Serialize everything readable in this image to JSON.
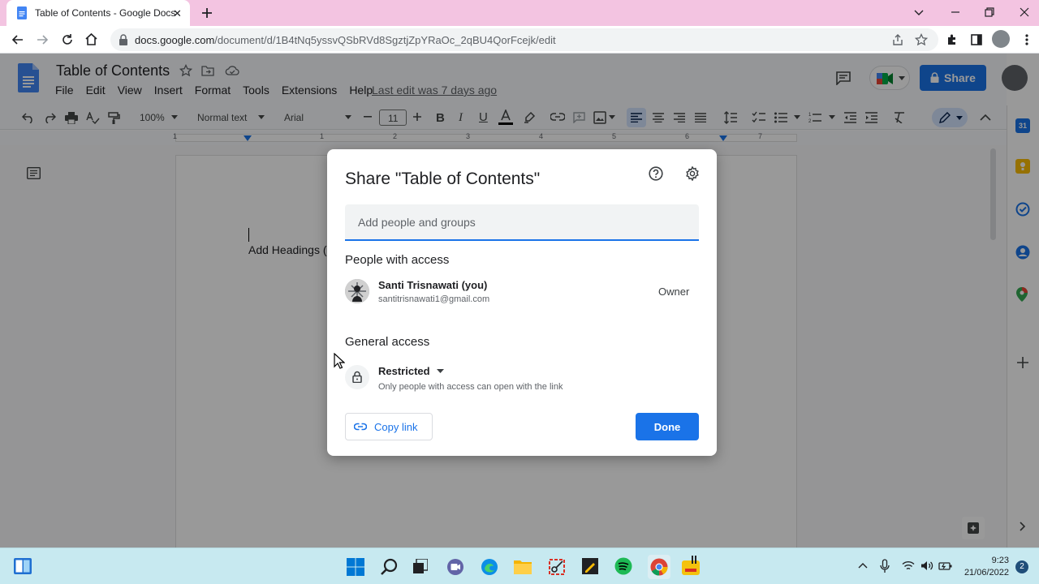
{
  "browser": {
    "tab_title": "Table of Contents - Google Docs",
    "url_host": "docs.google.com",
    "url_path": "/document/d/1B4tNq5yssvQSbRVd8SgztjZpYRaOc_2qBU4QorFcejk/edit"
  },
  "docs": {
    "title": "Table of Contents",
    "menu": [
      "File",
      "Edit",
      "View",
      "Insert",
      "Format",
      "Tools",
      "Extensions",
      "Help"
    ],
    "last_edit": "Last edit was 7 days ago",
    "share_label": "Share",
    "toolbar": {
      "zoom": "100%",
      "style": "Normal text",
      "font": "Arial",
      "font_size": "11"
    },
    "ruler_numbers": [
      "1",
      "1",
      "2",
      "3",
      "4",
      "5",
      "6",
      "7"
    ],
    "page_text": "Add Headings ("
  },
  "dialog": {
    "title": "Share \"Table of Contents\"",
    "input_placeholder": "Add people and groups",
    "people_heading": "People with access",
    "person": {
      "name": "Santi Trisnawati (you)",
      "email": "santitrisnawati1@gmail.com",
      "role": "Owner"
    },
    "general_heading": "General access",
    "access_level": "Restricted",
    "access_desc": "Only people with access can open with the link",
    "copy_link": "Copy link",
    "done": "Done"
  },
  "taskbar": {
    "time": "9:23",
    "date": "21/06/2022",
    "notification_count": "2"
  },
  "colors": {
    "accent": "#1a73e8",
    "tabstrip": "#f3c4e1",
    "taskbar": "#c7e9f0"
  }
}
